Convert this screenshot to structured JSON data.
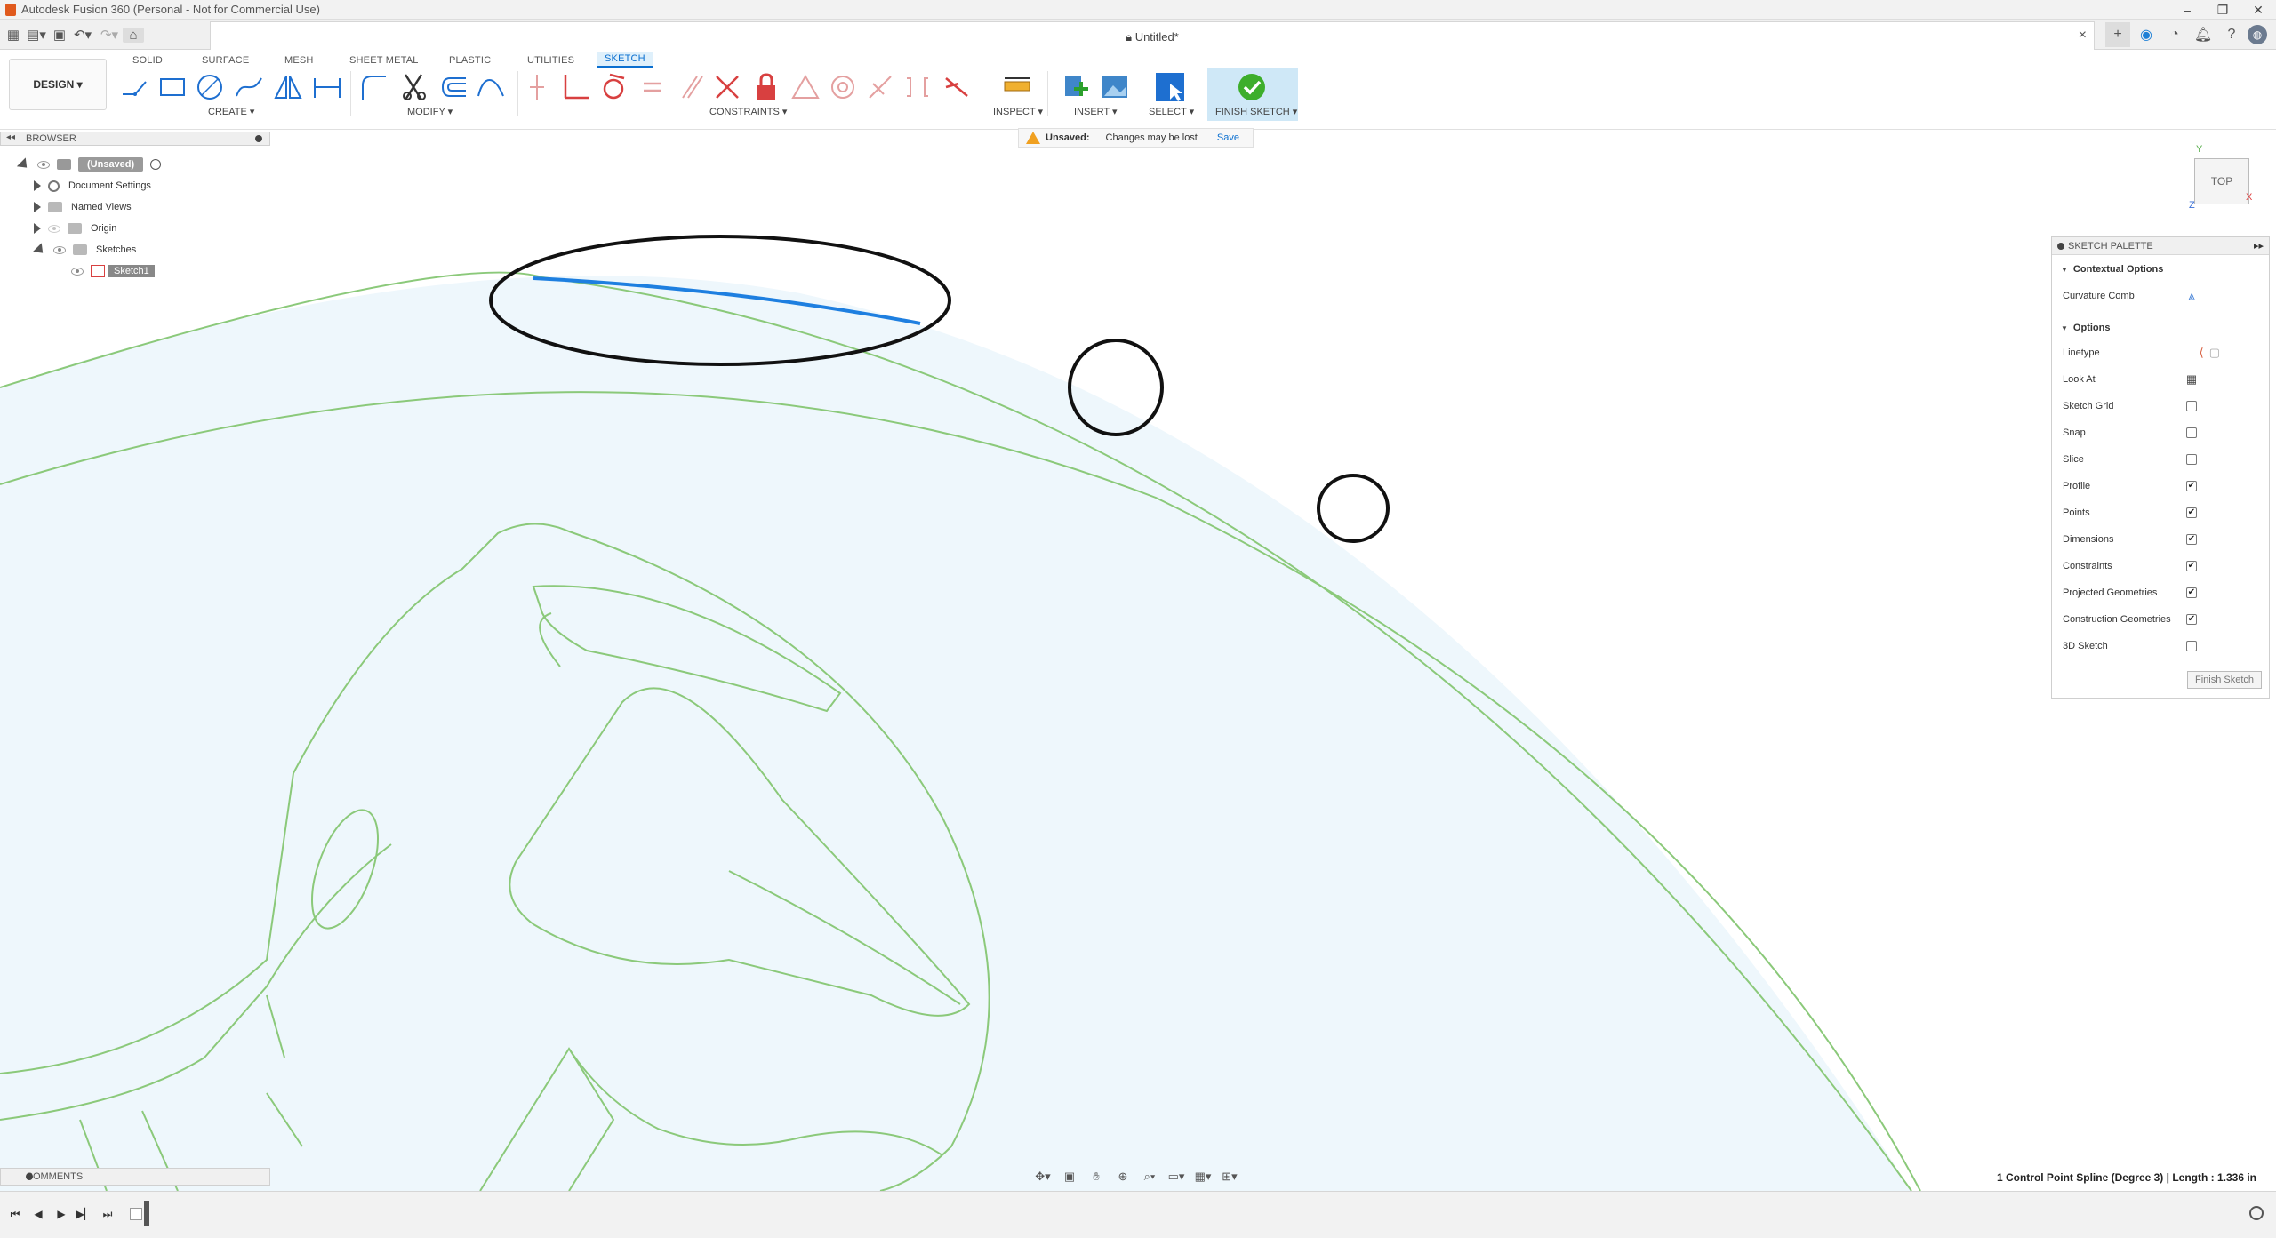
{
  "window": {
    "title": "Autodesk Fusion 360 (Personal - Not for Commercial Use)",
    "document_title": "Untitled*"
  },
  "ribbon": {
    "design_label": "DESIGN",
    "tabs": [
      {
        "label": "SOLID"
      },
      {
        "label": "SURFACE"
      },
      {
        "label": "MESH"
      },
      {
        "label": "SHEET METAL"
      },
      {
        "label": "PLASTIC"
      },
      {
        "label": "UTILITIES"
      },
      {
        "label": "SKETCH"
      }
    ],
    "active_tab": "SKETCH",
    "groups": {
      "create": "CREATE",
      "modify": "MODIFY",
      "constraints": "CONSTRAINTS",
      "inspect": "INSPECT",
      "insert": "INSERT",
      "select": "SELECT",
      "finish": "FINISH SKETCH"
    }
  },
  "browser": {
    "header": "BROWSER",
    "root_label": "(Unsaved)",
    "items": [
      {
        "label": "Document Settings"
      },
      {
        "label": "Named Views"
      },
      {
        "label": "Origin"
      },
      {
        "label": "Sketches"
      },
      {
        "label": "Sketch1"
      }
    ]
  },
  "notification": {
    "title": "Unsaved:",
    "message": "Changes may be lost",
    "action": "Save"
  },
  "viewcube": {
    "face": "TOP",
    "x": "X",
    "y": "Y",
    "z": "Z"
  },
  "palette": {
    "title": "SKETCH PALETTE",
    "contextual_section": "Contextual Options",
    "curvature_comb": "Curvature Comb",
    "options_section": "Options",
    "rows": [
      {
        "label": "Linetype",
        "type": "icons"
      },
      {
        "label": "Look At",
        "type": "icon"
      },
      {
        "label": "Sketch Grid",
        "type": "check",
        "checked": false,
        "mark": ""
      },
      {
        "label": "Snap",
        "type": "check",
        "checked": false,
        "mark": ""
      },
      {
        "label": "Slice",
        "type": "check",
        "checked": false,
        "mark": ""
      },
      {
        "label": "Profile",
        "type": "check",
        "checked": true,
        "mark": "✔"
      },
      {
        "label": "Points",
        "type": "check",
        "checked": true,
        "mark": "✔"
      },
      {
        "label": "Dimensions",
        "type": "check",
        "checked": true,
        "mark": "✔"
      },
      {
        "label": "Constraints",
        "type": "check",
        "checked": true,
        "mark": "✔"
      },
      {
        "label": "Projected Geometries",
        "type": "check",
        "checked": true,
        "mark": "✔"
      },
      {
        "label": "Construction Geometries",
        "type": "check",
        "checked": true,
        "mark": "✔"
      },
      {
        "label": "3D Sketch",
        "type": "check",
        "checked": false,
        "mark": ""
      }
    ],
    "finish_button": "Finish Sketch"
  },
  "comments": {
    "label": "COMMENTS"
  },
  "status": {
    "selection": "1 Control Point Spline (Degree 3) | Length : 1.336 in"
  },
  "colors": {
    "accent": "#0a6fd0",
    "sketch_line": "#7cc26a",
    "selected_spline": "#1e7fe0",
    "profile_fill": "#eef7fc"
  }
}
